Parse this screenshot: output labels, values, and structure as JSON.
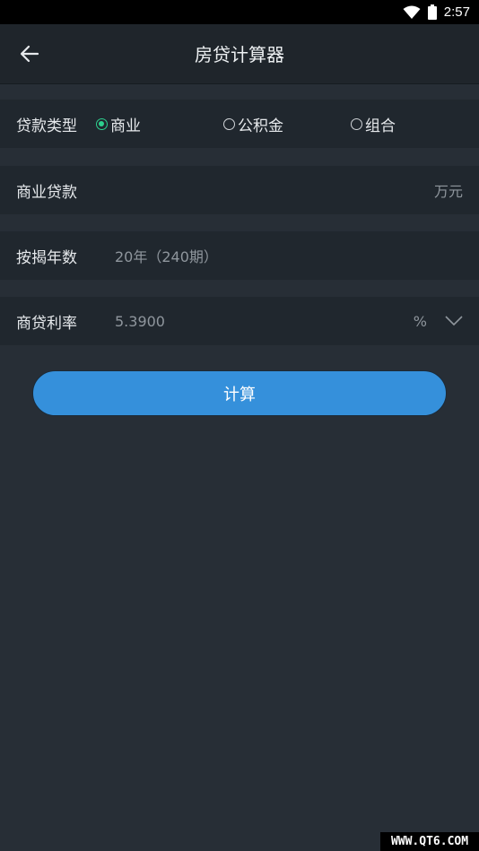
{
  "status_bar": {
    "time": "2:57",
    "icons": [
      "wifi-icon",
      "battery-icon"
    ]
  },
  "header": {
    "back_icon": "arrow-left-icon",
    "title": "房贷计算器"
  },
  "loan_type": {
    "label": "贷款类型",
    "options": [
      {
        "label": "商业",
        "selected": true
      },
      {
        "label": "公积金",
        "selected": false
      },
      {
        "label": "组合",
        "selected": false
      }
    ]
  },
  "commercial_loan": {
    "label": "商业贷款",
    "unit": "万元"
  },
  "term": {
    "label": "按揭年数",
    "value": "20年（240期）"
  },
  "rate": {
    "label": "商贷利率",
    "value": "5.3900",
    "unit": "%",
    "icon": "chevron-down-icon"
  },
  "calculate_button": {
    "label": "计算"
  },
  "watermark": {
    "text": "WWW.QT6.COM"
  },
  "colors": {
    "accent": "#3590db",
    "radio_selected": "#2dd08e",
    "background": "#272e36",
    "row": "#20272e"
  }
}
